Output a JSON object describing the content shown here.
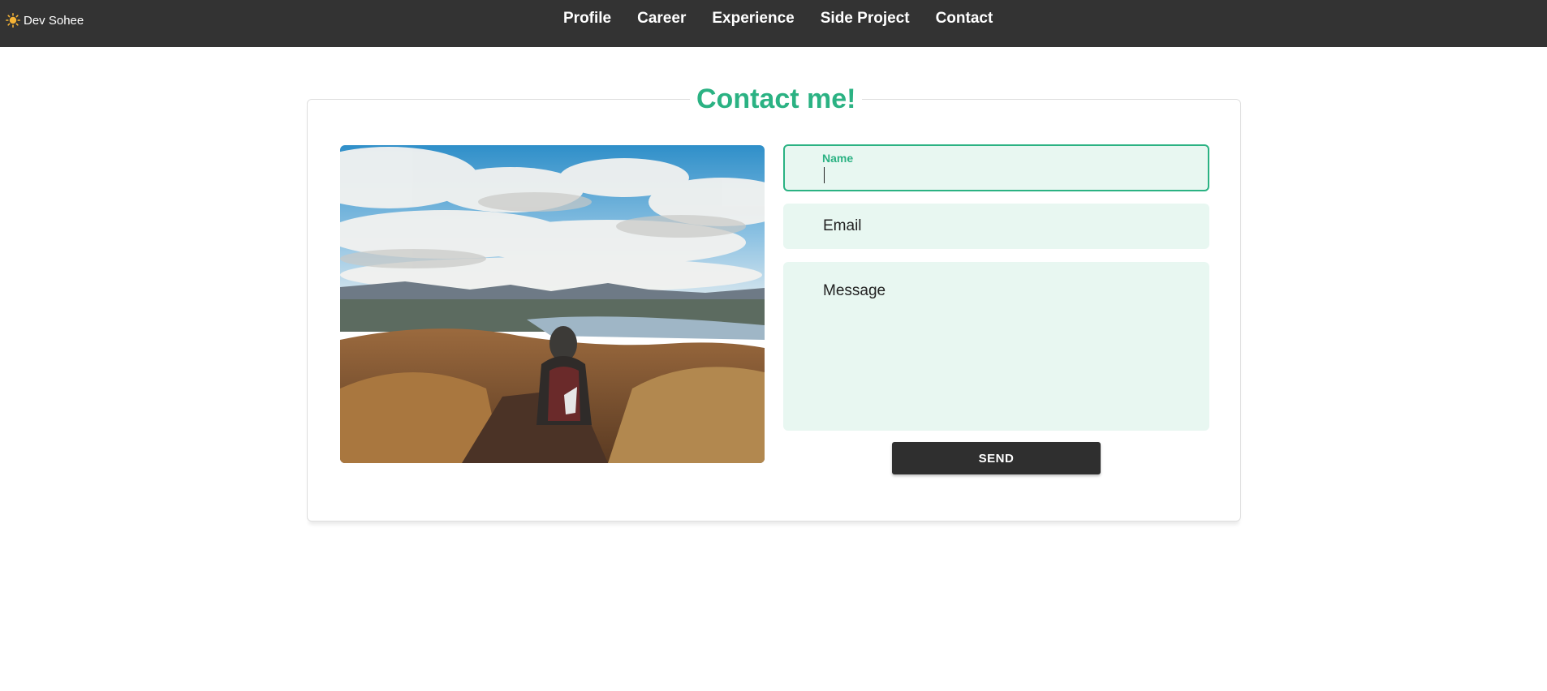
{
  "brand": {
    "icon": "sun-icon",
    "label": "Dev Sohee"
  },
  "nav": {
    "items": [
      {
        "label": "Profile"
      },
      {
        "label": "Career"
      },
      {
        "label": "Experience"
      },
      {
        "label": "Side Project"
      },
      {
        "label": "Contact"
      }
    ]
  },
  "contact": {
    "title": "Contact me!",
    "form": {
      "name": {
        "label": "Name",
        "value": ""
      },
      "email": {
        "placeholder": "Email",
        "value": ""
      },
      "message": {
        "placeholder": "Message",
        "value": ""
      },
      "send_label": "SEND"
    }
  },
  "colors": {
    "accent": "#2bb283",
    "field_bg": "#e8f7f1",
    "topbar": "#333333",
    "button": "#2f2f2f"
  }
}
